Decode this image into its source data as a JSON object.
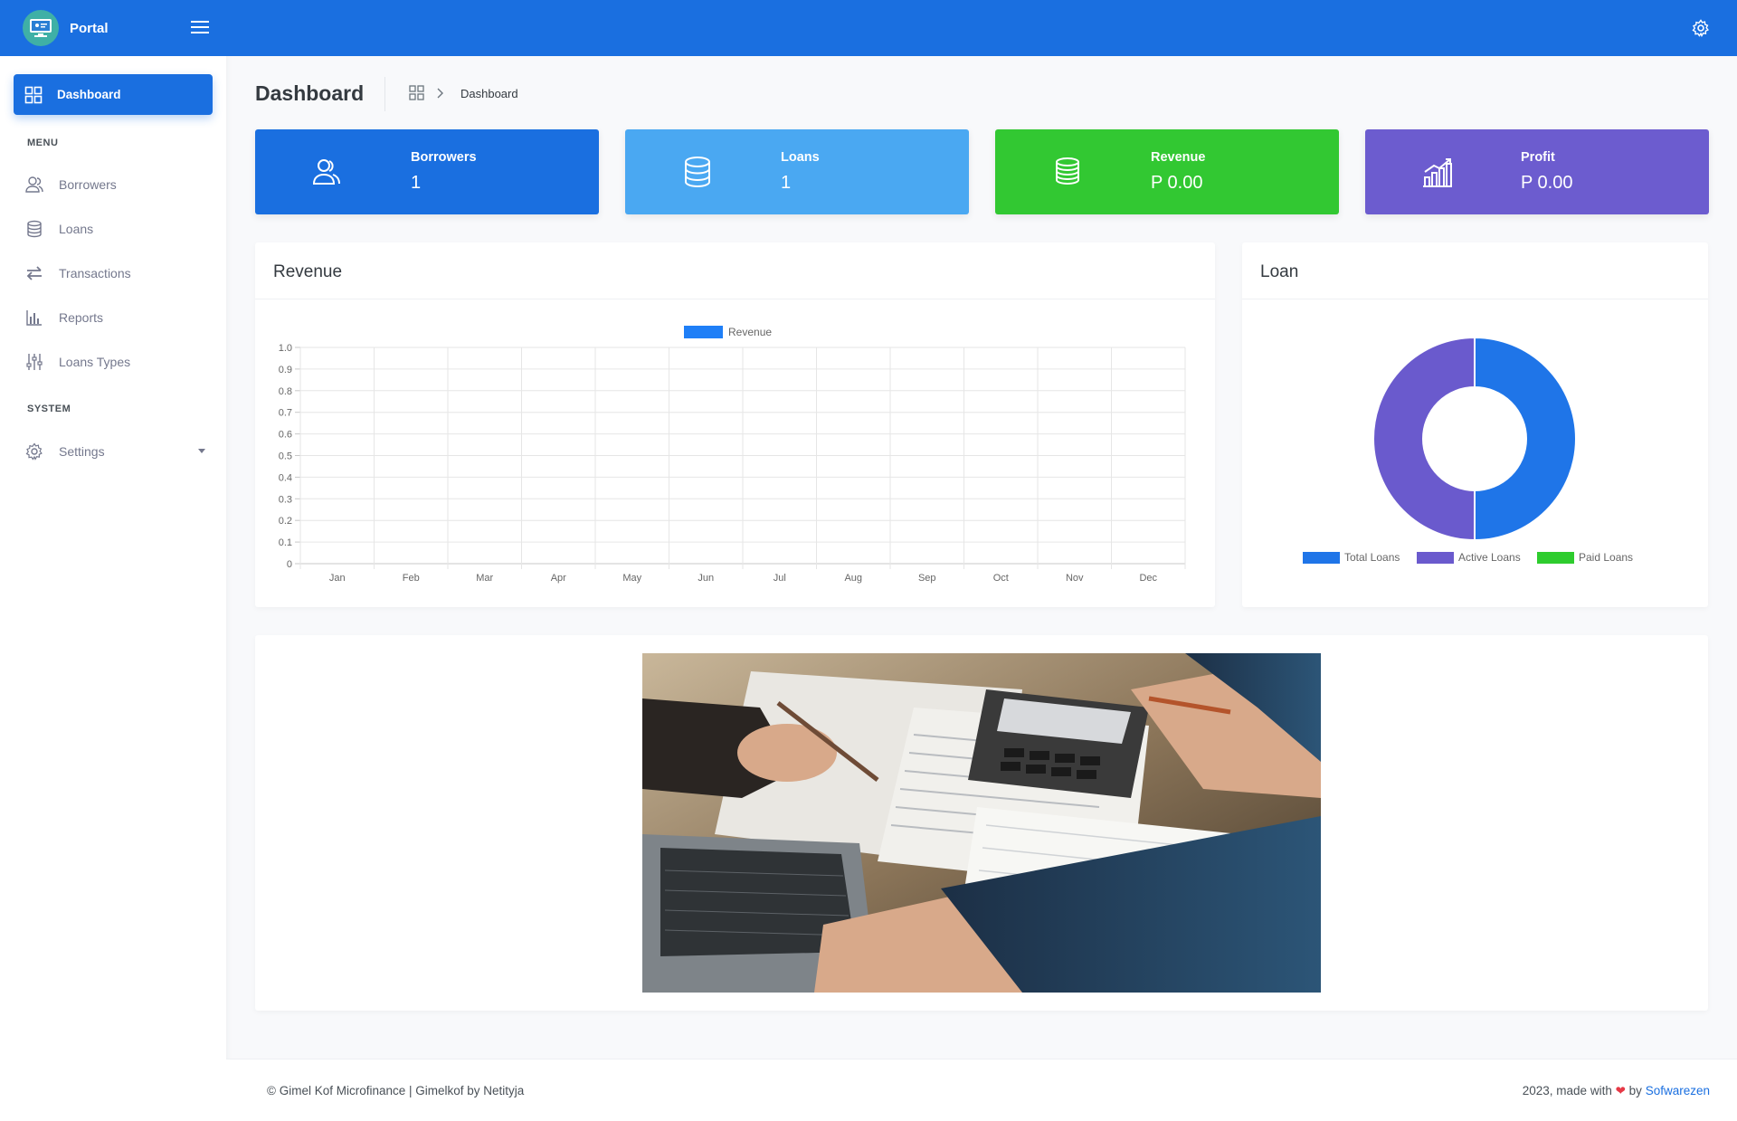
{
  "brand": {
    "name": "Portal"
  },
  "sidebar": {
    "active": {
      "label": "Dashboard"
    },
    "menu_heading": "MENU",
    "items": [
      {
        "label": "Borrowers",
        "icon": "users-icon"
      },
      {
        "label": "Loans",
        "icon": "database-icon"
      },
      {
        "label": "Transactions",
        "icon": "swap-arrows-icon"
      },
      {
        "label": "Reports",
        "icon": "bar-chart-icon"
      },
      {
        "label": "Loans Types",
        "icon": "sliders-icon"
      }
    ],
    "system_heading": "SYSTEM",
    "settings": {
      "label": "Settings",
      "icon": "gear-icon"
    }
  },
  "page": {
    "title": "Dashboard",
    "breadcrumb_current": "Dashboard"
  },
  "stats": [
    {
      "label": "Borrowers",
      "value": "1",
      "color": "#1a6fe0",
      "icon": "users-icon"
    },
    {
      "label": "Loans",
      "value": "1",
      "color": "#4aa8f2",
      "icon": "database-icon"
    },
    {
      "label": "Revenue",
      "value": "P 0.00",
      "color": "#32c832",
      "icon": "coins-icon"
    },
    {
      "label": "Profit",
      "value": "P 0.00",
      "color": "#6c5ccf",
      "icon": "growth-chart-icon"
    }
  ],
  "revenue_card": {
    "title": "Revenue"
  },
  "loan_card": {
    "title": "Loan"
  },
  "chart_data": [
    {
      "type": "bar",
      "categories": [
        "Jan",
        "Feb",
        "Mar",
        "Apr",
        "May",
        "Jun",
        "Jul",
        "Aug",
        "Sep",
        "Oct",
        "Nov",
        "Dec"
      ],
      "series": [
        {
          "name": "Revenue",
          "values": [
            0,
            0,
            0,
            0,
            0,
            0,
            0,
            0,
            0,
            0,
            0,
            0
          ],
          "color": "#1f7ff7"
        }
      ],
      "yticks": [
        "1.0",
        "0.9",
        "0.8",
        "0.7",
        "0.6",
        "0.5",
        "0.4",
        "0.3",
        "0.2",
        "0.1",
        "0"
      ],
      "ylim": [
        0,
        1
      ],
      "grid": true,
      "legend": "top"
    },
    {
      "type": "pie",
      "variant": "doughnut",
      "labels": [
        "Total Loans",
        "Active Loans",
        "Paid Loans"
      ],
      "values": [
        1,
        1,
        0
      ],
      "colors": [
        "#1f75e8",
        "#6a5acd",
        "#2ecc2e"
      ],
      "legend": "bottom"
    }
  ],
  "footer": {
    "left": "© Gimel Kof Microfinance | Gimelkof by Netityja",
    "right_prefix": "2023, made with",
    "heart": "❤",
    "right_by": "by",
    "right_link": "Sofwarezen"
  }
}
